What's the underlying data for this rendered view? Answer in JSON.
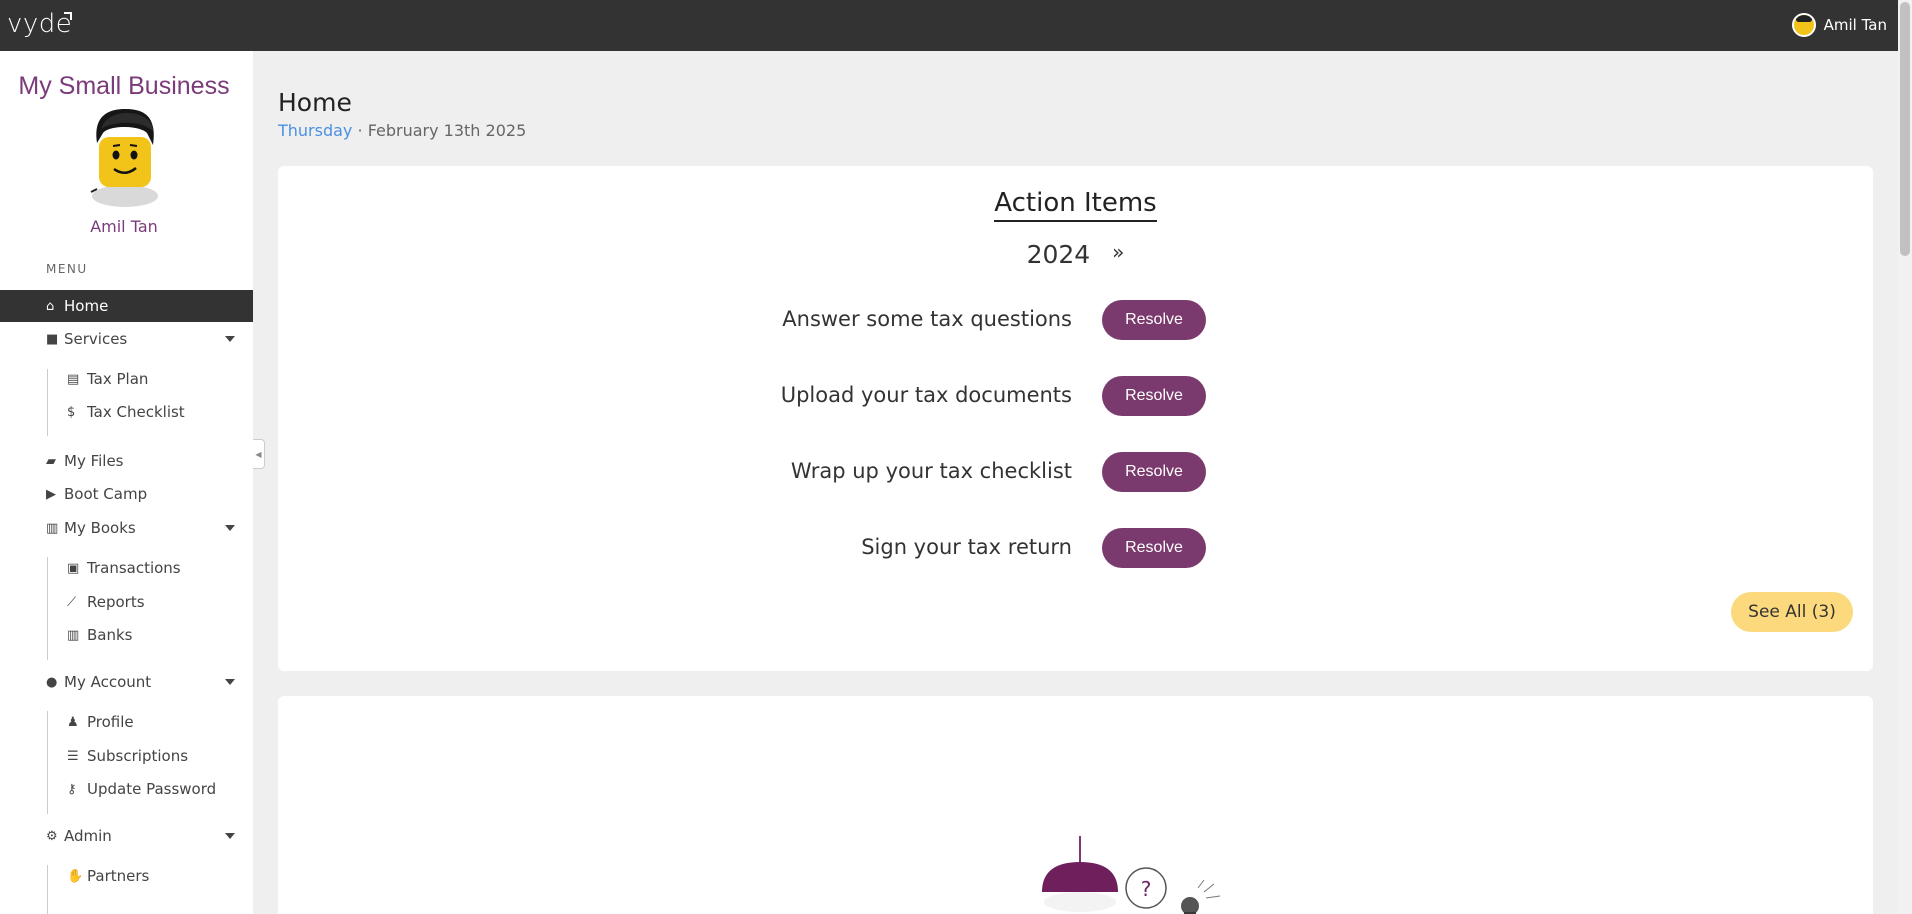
{
  "topbar": {
    "logo": "vyde",
    "user_name": "Amil Tan"
  },
  "sidebar": {
    "business_name": "My Small Business",
    "user_name": "Amil Tan",
    "menu_label": "MENU",
    "items": {
      "home": "Home",
      "services": "Services",
      "tax_plan": "Tax Plan",
      "tax_checklist": "Tax Checklist",
      "my_files": "My Files",
      "boot_camp": "Boot Camp",
      "my_books": "My Books",
      "transactions": "Transactions",
      "reports": "Reports",
      "banks": "Banks",
      "my_account": "My Account",
      "profile": "Profile",
      "subscriptions": "Subscriptions",
      "update_password": "Update Password",
      "admin": "Admin",
      "partners": "Partners"
    }
  },
  "header": {
    "title": "Home",
    "day": "Thursday",
    "separator": "·",
    "date": "February 13th 2025"
  },
  "action_items": {
    "title": "Action Items",
    "year": "2024",
    "next_icon": "»",
    "tasks": [
      {
        "label": "Answer some tax questions",
        "button": "Resolve"
      },
      {
        "label": "Upload your tax documents",
        "button": "Resolve"
      },
      {
        "label": "Wrap up your tax checklist",
        "button": "Resolve"
      },
      {
        "label": "Sign your tax return",
        "button": "Resolve"
      }
    ],
    "see_all": "See All (3)"
  },
  "illustration": {
    "bubble_text": "?"
  },
  "colors": {
    "topbar": "#333333",
    "brand_purple": "#7b3a6e",
    "see_all_yellow": "#fcd97d",
    "date_blue": "#4a90e2"
  }
}
